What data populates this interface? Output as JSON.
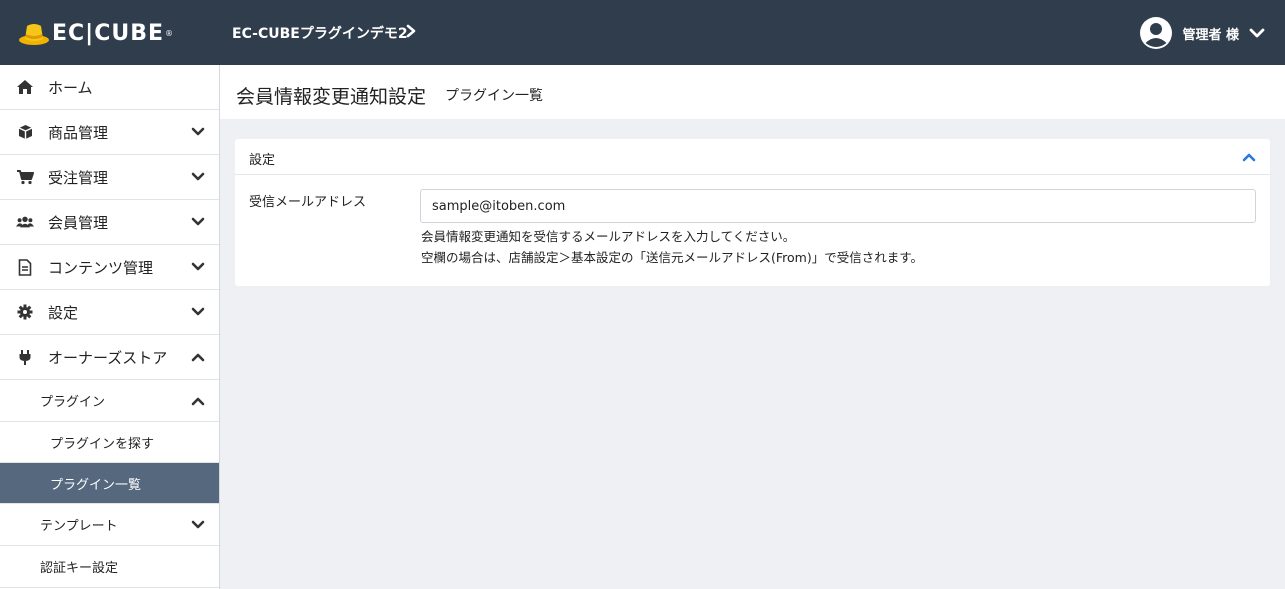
{
  "header": {
    "logo_text": "EC|CUBE",
    "logo_mark": "®",
    "shop_name": "EC-CUBEプラグインデモ2",
    "user_name": "管理者 様",
    "bg_color": "#2f3d4c"
  },
  "sidebar": {
    "items": [
      {
        "label": "ホーム",
        "icon": "home-icon"
      },
      {
        "label": "商品管理",
        "icon": "box-icon"
      },
      {
        "label": "受注管理",
        "icon": "cart-icon"
      },
      {
        "label": "会員管理",
        "icon": "users-icon"
      },
      {
        "label": "コンテンツ管理",
        "icon": "file-icon"
      },
      {
        "label": "設定",
        "icon": "gear-icon"
      },
      {
        "label": "オーナーズストア",
        "icon": "plug-icon"
      }
    ],
    "owners_store": {
      "plugin": "プラグイン",
      "plugin_search": "プラグインを探す",
      "plugin_list": "プラグイン一覧",
      "template": "テンプレート",
      "auth_key": "認証キー設定"
    },
    "active_color": "#55687d"
  },
  "page": {
    "title": "会員情報変更通知設定",
    "subtitle": "プラグイン一覧"
  },
  "card": {
    "title": "設定",
    "field_label": "受信メールアドレス",
    "field_value": "sample@itoben.com",
    "help_line1": "会員情報変更通知を受信するメールアドレスを入力してください。",
    "help_line2": "空欄の場合は、店舗設定＞基本設定の「送信元メールアドレス(From)」で受信されます。"
  }
}
